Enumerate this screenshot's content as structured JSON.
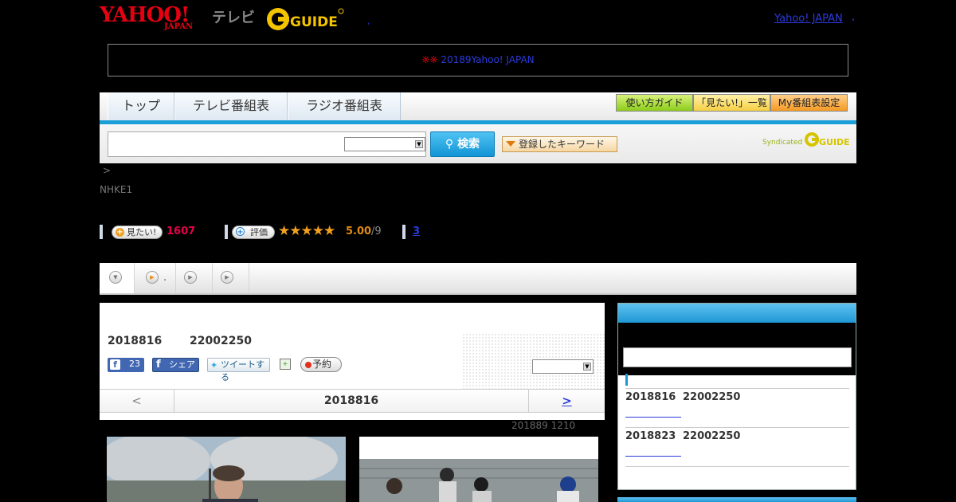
{
  "header": {
    "logo_yahoo": "YAHOO!",
    "logo_japan": "JAPAN",
    "logo_tv": "テレビ",
    "logo_gguide": "GUIDE",
    "top_link": "Yahoo! JAPAN",
    "dot": ",",
    "dot2": ","
  },
  "notice": {
    "mark": "※※",
    "link": "20189Yahoo! JAPAN　　　　"
  },
  "nav": {
    "tabs": [
      "トップ",
      "テレビ番組表",
      "ラジオ番組表"
    ],
    "buttons": [
      "使い方ガイド",
      "「見たい!」一覧",
      "My番組表設定"
    ]
  },
  "search": {
    "placeholder": "",
    "button": "検索",
    "keyword_button": "登録したキーワード",
    "syndicated": "Syndicated",
    "gguide": "GUIDE"
  },
  "breadcrumb": ">",
  "channel": "NHKE1",
  "stats": {
    "mitai_label": "見たい!",
    "mitai_count": "1607",
    "rate_label": "評価",
    "stars": "★★★★★",
    "score": "5.00",
    "score_of": "/9",
    "reviews": "3"
  },
  "strip": {
    "dot": "."
  },
  "program": {
    "date": "2018816",
    "time": "22002250",
    "fb_like_count": "23",
    "fb_share": "シェア",
    "tweet": "ツイートする",
    "reserve": "予約",
    "prev": "<",
    "current_date": "2018816",
    "next": ">",
    "updated": "201889  1210"
  },
  "sidebar": {
    "items": [
      {
        "date": "2018816",
        "time": "22002250"
      },
      {
        "date": "2018823",
        "time": "22002250"
      }
    ]
  },
  "colors": {
    "accent_blue": "#1b9fd8",
    "yahoo_red": "#e60012",
    "link_blue": "#2b3bdc",
    "count_pink": "#e6004a",
    "star_orange": "#f2a11f"
  }
}
